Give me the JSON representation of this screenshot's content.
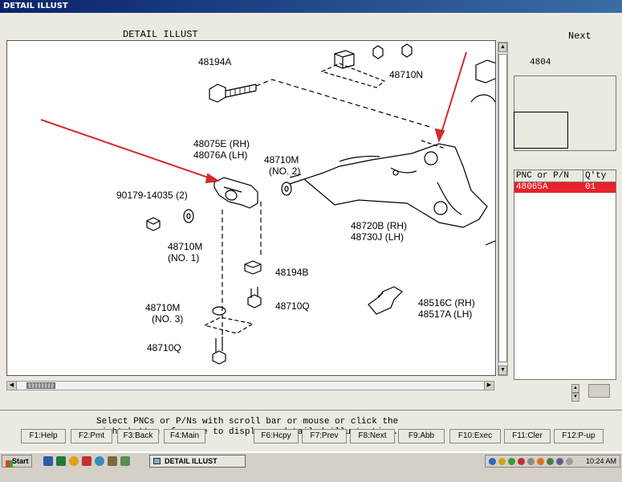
{
  "window": {
    "title": "DETAIL ILLUST"
  },
  "header": {
    "detail_label": "DETAIL ILLUST",
    "next_label": "Next"
  },
  "side_panel": {
    "current_code": "4804"
  },
  "parts_table": {
    "headers": [
      "PNC or P/N",
      "Q'ty"
    ],
    "rows": [
      {
        "pn": "48065A",
        "qty": "01"
      }
    ]
  },
  "illustration": {
    "labels": {
      "l1": "48194A",
      "l2": "48710N",
      "l3": "48075E (RH)",
      "l4": "48076A (LH)",
      "l5": "48710M",
      "l6": "(NO. 2)",
      "l7": "90179-14035 (2)",
      "l8": "48710M",
      "l9": "(NO. 1)",
      "l10": "48720B (RH)",
      "l11": "48730J (LH)",
      "l12": "48194B",
      "l13": "48710M",
      "l14": "(NO. 3)",
      "l15": "48710Q",
      "l16": "48710Q",
      "l17": "48516C (RH)",
      "l18": "48517A (LH)"
    },
    "arrow_color": "#d42a2a"
  },
  "message": {
    "line1": "Select PNCs or P/Ns with scroll bar or mouse or click the",
    "line2": "right button of mouse to display a detailed illustration."
  },
  "function_keys": [
    "F1:Help",
    "F2:Pmt",
    "F3:Back",
    "F4:Main",
    "F6:Hcpy",
    "F7:Prev",
    "F8:Next",
    "F9:Abb",
    "F10:Exec",
    "F11:Cler",
    "F12:P-up"
  ],
  "taskbar": {
    "start_label": "Start",
    "task_label": "DETAIL ILLUST",
    "clock": "10:24 AM"
  }
}
